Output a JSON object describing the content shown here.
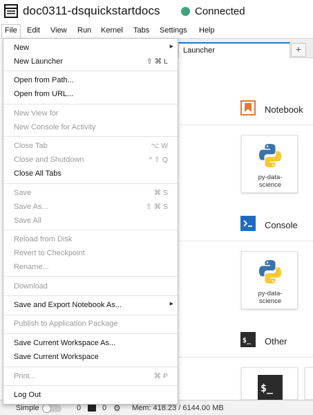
{
  "header": {
    "title": "doc0311-dsquickstartdocs",
    "status": "Connected",
    "status_color": "#3fa37c"
  },
  "menubar": {
    "items": [
      "File",
      "Edit",
      "View",
      "Run",
      "Kernel",
      "Tabs",
      "Settings",
      "Help"
    ]
  },
  "launcher": {
    "tab_label": "Launcher",
    "add_tab_label": "+",
    "sections": [
      {
        "label": "Notebook",
        "icon": "bookmark-icon",
        "card_label": "py-data-\nscience",
        "card_icon": "python-logo-icon"
      },
      {
        "label": "Console",
        "icon": "terminal-prompt-icon",
        "card_label": "py-data-\nscience",
        "card_icon": "python-logo-icon"
      },
      {
        "label": "Other",
        "icon": "terminal-icon",
        "card_label": "",
        "card_icon": "terminal-icon"
      }
    ]
  },
  "file_menu": {
    "items": [
      {
        "label": "New",
        "shortcut": "",
        "disabled": false,
        "submenu": true
      },
      {
        "label": "New Launcher",
        "shortcut": "⇧ ⌘ L",
        "disabled": false
      },
      {
        "label": "Open from Path...",
        "shortcut": "",
        "disabled": false
      },
      {
        "label": "Open from URL...",
        "shortcut": "",
        "disabled": false
      },
      {
        "label": "New View for",
        "shortcut": "",
        "disabled": true
      },
      {
        "label": "New Console for Activity",
        "shortcut": "",
        "disabled": true
      },
      {
        "label": "Close Tab",
        "shortcut": "⌥ W",
        "disabled": true
      },
      {
        "label": "Close and Shutdown",
        "shortcut": "^ ⇧ Q",
        "disabled": true
      },
      {
        "label": "Close All Tabs",
        "shortcut": "",
        "disabled": false
      },
      {
        "label": "Save",
        "shortcut": "⌘ S",
        "disabled": true
      },
      {
        "label": "Save As...",
        "shortcut": "⇧ ⌘ S",
        "disabled": true
      },
      {
        "label": "Save All",
        "shortcut": "",
        "disabled": true
      },
      {
        "label": "Reload from Disk",
        "shortcut": "",
        "disabled": true
      },
      {
        "label": "Revert to Checkpoint",
        "shortcut": "",
        "disabled": true
      },
      {
        "label": "Rename...",
        "shortcut": "",
        "disabled": true
      },
      {
        "label": "Download",
        "shortcut": "",
        "disabled": true
      },
      {
        "label": "Save and Export Notebook As...",
        "shortcut": "",
        "disabled": false,
        "submenu": true
      },
      {
        "label": "Publish to Application Package",
        "shortcut": "",
        "disabled": true
      },
      {
        "label": "Save Current Workspace As...",
        "shortcut": "",
        "disabled": false
      },
      {
        "label": "Save Current Workspace",
        "shortcut": "",
        "disabled": false
      },
      {
        "label": "Print...",
        "shortcut": "⌘ P",
        "disabled": true
      },
      {
        "label": "Log Out",
        "shortcut": "",
        "disabled": false
      }
    ]
  },
  "statusbar": {
    "simple_label": "Simple",
    "terminals_count": "0",
    "kernels_count": "0",
    "memory": "Mem: 418.23 / 6144.00 MB"
  },
  "colors": {
    "notebook_icon": "#e07a33",
    "console_icon": "#1e6bc4",
    "accent": "#1976d2"
  }
}
